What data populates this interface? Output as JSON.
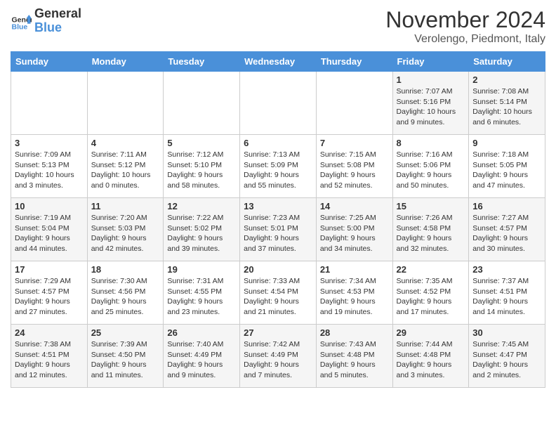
{
  "logo": {
    "text_general": "General",
    "text_blue": "Blue"
  },
  "title": "November 2024",
  "subtitle": "Verolengo, Piedmont, Italy",
  "weekdays": [
    "Sunday",
    "Monday",
    "Tuesday",
    "Wednesday",
    "Thursday",
    "Friday",
    "Saturday"
  ],
  "weeks": [
    [
      {
        "day": "",
        "info": ""
      },
      {
        "day": "",
        "info": ""
      },
      {
        "day": "",
        "info": ""
      },
      {
        "day": "",
        "info": ""
      },
      {
        "day": "",
        "info": ""
      },
      {
        "day": "1",
        "info": "Sunrise: 7:07 AM\nSunset: 5:16 PM\nDaylight: 10 hours and 9 minutes."
      },
      {
        "day": "2",
        "info": "Sunrise: 7:08 AM\nSunset: 5:14 PM\nDaylight: 10 hours and 6 minutes."
      }
    ],
    [
      {
        "day": "3",
        "info": "Sunrise: 7:09 AM\nSunset: 5:13 PM\nDaylight: 10 hours and 3 minutes."
      },
      {
        "day": "4",
        "info": "Sunrise: 7:11 AM\nSunset: 5:12 PM\nDaylight: 10 hours and 0 minutes."
      },
      {
        "day": "5",
        "info": "Sunrise: 7:12 AM\nSunset: 5:10 PM\nDaylight: 9 hours and 58 minutes."
      },
      {
        "day": "6",
        "info": "Sunrise: 7:13 AM\nSunset: 5:09 PM\nDaylight: 9 hours and 55 minutes."
      },
      {
        "day": "7",
        "info": "Sunrise: 7:15 AM\nSunset: 5:08 PM\nDaylight: 9 hours and 52 minutes."
      },
      {
        "day": "8",
        "info": "Sunrise: 7:16 AM\nSunset: 5:06 PM\nDaylight: 9 hours and 50 minutes."
      },
      {
        "day": "9",
        "info": "Sunrise: 7:18 AM\nSunset: 5:05 PM\nDaylight: 9 hours and 47 minutes."
      }
    ],
    [
      {
        "day": "10",
        "info": "Sunrise: 7:19 AM\nSunset: 5:04 PM\nDaylight: 9 hours and 44 minutes."
      },
      {
        "day": "11",
        "info": "Sunrise: 7:20 AM\nSunset: 5:03 PM\nDaylight: 9 hours and 42 minutes."
      },
      {
        "day": "12",
        "info": "Sunrise: 7:22 AM\nSunset: 5:02 PM\nDaylight: 9 hours and 39 minutes."
      },
      {
        "day": "13",
        "info": "Sunrise: 7:23 AM\nSunset: 5:01 PM\nDaylight: 9 hours and 37 minutes."
      },
      {
        "day": "14",
        "info": "Sunrise: 7:25 AM\nSunset: 5:00 PM\nDaylight: 9 hours and 34 minutes."
      },
      {
        "day": "15",
        "info": "Sunrise: 7:26 AM\nSunset: 4:58 PM\nDaylight: 9 hours and 32 minutes."
      },
      {
        "day": "16",
        "info": "Sunrise: 7:27 AM\nSunset: 4:57 PM\nDaylight: 9 hours and 30 minutes."
      }
    ],
    [
      {
        "day": "17",
        "info": "Sunrise: 7:29 AM\nSunset: 4:57 PM\nDaylight: 9 hours and 27 minutes."
      },
      {
        "day": "18",
        "info": "Sunrise: 7:30 AM\nSunset: 4:56 PM\nDaylight: 9 hours and 25 minutes."
      },
      {
        "day": "19",
        "info": "Sunrise: 7:31 AM\nSunset: 4:55 PM\nDaylight: 9 hours and 23 minutes."
      },
      {
        "day": "20",
        "info": "Sunrise: 7:33 AM\nSunset: 4:54 PM\nDaylight: 9 hours and 21 minutes."
      },
      {
        "day": "21",
        "info": "Sunrise: 7:34 AM\nSunset: 4:53 PM\nDaylight: 9 hours and 19 minutes."
      },
      {
        "day": "22",
        "info": "Sunrise: 7:35 AM\nSunset: 4:52 PM\nDaylight: 9 hours and 17 minutes."
      },
      {
        "day": "23",
        "info": "Sunrise: 7:37 AM\nSunset: 4:51 PM\nDaylight: 9 hours and 14 minutes."
      }
    ],
    [
      {
        "day": "24",
        "info": "Sunrise: 7:38 AM\nSunset: 4:51 PM\nDaylight: 9 hours and 12 minutes."
      },
      {
        "day": "25",
        "info": "Sunrise: 7:39 AM\nSunset: 4:50 PM\nDaylight: 9 hours and 11 minutes."
      },
      {
        "day": "26",
        "info": "Sunrise: 7:40 AM\nSunset: 4:49 PM\nDaylight: 9 hours and 9 minutes."
      },
      {
        "day": "27",
        "info": "Sunrise: 7:42 AM\nSunset: 4:49 PM\nDaylight: 9 hours and 7 minutes."
      },
      {
        "day": "28",
        "info": "Sunrise: 7:43 AM\nSunset: 4:48 PM\nDaylight: 9 hours and 5 minutes."
      },
      {
        "day": "29",
        "info": "Sunrise: 7:44 AM\nSunset: 4:48 PM\nDaylight: 9 hours and 3 minutes."
      },
      {
        "day": "30",
        "info": "Sunrise: 7:45 AM\nSunset: 4:47 PM\nDaylight: 9 hours and 2 minutes."
      }
    ]
  ]
}
